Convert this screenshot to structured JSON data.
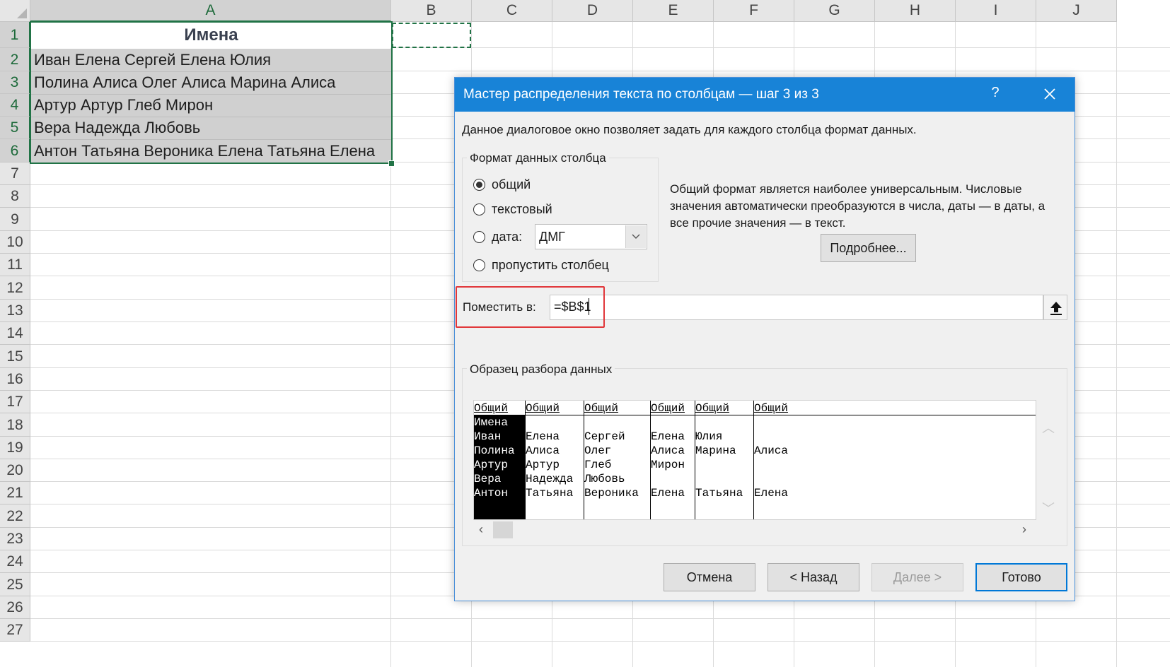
{
  "spreadsheet": {
    "columns": [
      "A",
      "B",
      "C",
      "D",
      "E",
      "F",
      "G",
      "H",
      "I",
      "J"
    ],
    "rows": [
      "1",
      "2",
      "3",
      "4",
      "5",
      "6",
      "7",
      "8",
      "9",
      "10",
      "11",
      "12",
      "13",
      "14",
      "15",
      "16",
      "17",
      "18",
      "19",
      "20",
      "21",
      "22",
      "23",
      "24",
      "25",
      "26",
      "27"
    ],
    "cells": {
      "A1": "Имена",
      "A2": "Иван Елена Сергей Елена Юлия",
      "A3": "Полина Алиса Олег Алиса Марина Алиса",
      "A4": "Артур Артур Глеб Мирон",
      "A5": "Вера Надежда Любовь",
      "A6": "Антон Татьяна Вероника Елена Татьяна Елена"
    },
    "selection_color": "#217346"
  },
  "dialog": {
    "title": "Мастер распределения текста по столбцам — шаг 3 из 3",
    "help": "?",
    "description": "Данное диалоговое окно позволяет задать для каждого столбца формат данных.",
    "format_group": {
      "legend": "Формат данных столбца",
      "options": [
        {
          "label": "общий",
          "checked": true
        },
        {
          "label": "текстовый",
          "checked": false
        },
        {
          "label": "дата:",
          "checked": false
        },
        {
          "label": "пропустить столбец",
          "checked": false
        }
      ],
      "date_format": "ДМГ"
    },
    "info_text": "Общий формат является наиболее универсальным. Числовые значения автоматически преобразуются в числа, даты — в даты, а все прочие значения — в текст.",
    "details_button": "Подробнее...",
    "destination": {
      "label": "Поместить в:",
      "value": "=$B$1"
    },
    "preview": {
      "legend": "Образец разбора данных",
      "headers": [
        "Общий",
        "Общий",
        "Общий",
        "Общий",
        "Общий",
        "Общий"
      ],
      "rows": [
        [
          "Имена",
          "",
          "",
          "",
          "",
          ""
        ],
        [
          "Иван",
          "Елена",
          "Сергей",
          "Елена",
          "Юлия",
          ""
        ],
        [
          "Полина",
          "Алиса",
          "Олег",
          "Алиса",
          "Марина",
          "Алиса"
        ],
        [
          "Артур",
          "Артур",
          "Глеб",
          "Мирон",
          "",
          ""
        ],
        [
          "Вера",
          "Надежда",
          "Любовь",
          "",
          "",
          ""
        ],
        [
          "Антон",
          "Татьяна",
          "Вероника",
          "Елена",
          "Татьяна",
          "Елена"
        ]
      ]
    },
    "buttons": {
      "cancel": "Отмена",
      "back": "< Назад",
      "next": "Далее >",
      "finish": "Готово"
    },
    "title_bar_color": "#1883d7",
    "highlight_color": "#e1373a"
  }
}
